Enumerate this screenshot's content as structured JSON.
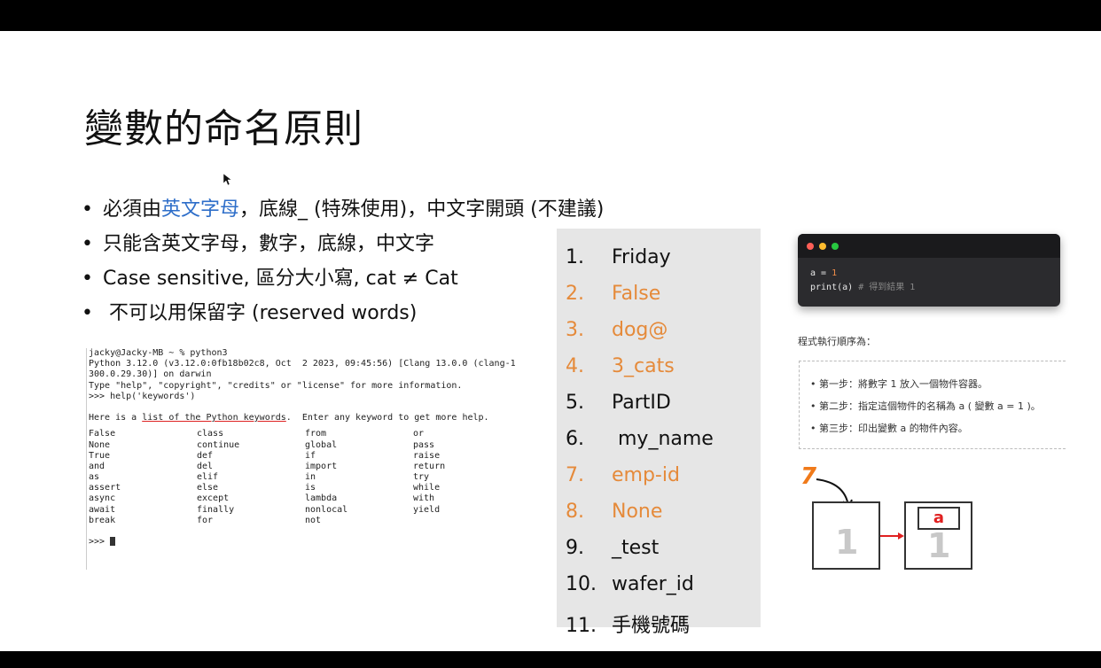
{
  "title": "變數的命名原則",
  "bullets": [
    {
      "pre": "必須由",
      "highlight": "英文字母",
      "post": "，底線_ (特殊使用)，中文字開頭 (不建議)"
    },
    {
      "pre": "只能含英文字母，數字，底線，中文字",
      "highlight": "",
      "post": ""
    },
    {
      "pre": "Case sensitive, 區分大小寫, cat ≠ Cat",
      "highlight": "",
      "post": ""
    },
    {
      "pre": " 不可以用保留字 (reserved words)",
      "highlight": "",
      "post": ""
    }
  ],
  "terminal": {
    "lines": [
      "jacky@Jacky-MB ~ % python3",
      "Python 3.12.0 (v3.12.0:0fb18b02c8, Oct  2 2023, 09:45:56) [Clang 13.0.0 (clang-1",
      "300.0.29.30)] on darwin",
      "Type \"help\", \"copyright\", \"credits\" or \"license\" for more information.",
      ">>> help('keywords')",
      ""
    ],
    "help_pre": "Here is a ",
    "help_link": "list of the Python keywords",
    "help_post": ".  Enter any keyword to get more help.",
    "keywords": [
      "False",
      "class",
      "from",
      "or",
      "None",
      "continue",
      "global",
      "pass",
      "True",
      "def",
      "if",
      "raise",
      "and",
      "del",
      "import",
      "return",
      "as",
      "elif",
      "in",
      "try",
      "assert",
      "else",
      "is",
      "while",
      "async",
      "except",
      "lambda",
      "with",
      "await",
      "finally",
      "nonlocal",
      "yield",
      "break",
      "for",
      "not",
      ""
    ],
    "prompt": ">>> "
  },
  "names": [
    {
      "num": "1.",
      "text": "Friday",
      "color": "#111111"
    },
    {
      "num": "2.",
      "text": "False",
      "color": "#e58a3a"
    },
    {
      "num": "3.",
      "text": "dog@",
      "color": "#e58a3a"
    },
    {
      "num": "4.",
      "text": "3_cats",
      "color": "#e58a3a"
    },
    {
      "num": "5.",
      "text": "PartID",
      "color": "#111111"
    },
    {
      "num": "6.",
      "text": " my_name",
      "color": "#111111"
    },
    {
      "num": "7.",
      "text": "emp-id",
      "color": "#e58a3a"
    },
    {
      "num": "8.",
      "text": "None",
      "color": "#e58a3a"
    },
    {
      "num": "9.",
      "text": "_test",
      "color": "#111111"
    },
    {
      "num": "10.",
      "text": "wafer_id",
      "color": "#111111"
    },
    {
      "num": "11.",
      "text": "手機號碼",
      "color": "#111111"
    }
  ],
  "code": {
    "line1_pre": "a = ",
    "line1_num": "1",
    "line2_pre": "print(a) ",
    "line2_comment": "# 得到結果 1"
  },
  "order_label": "程式執行順序為：",
  "steps": [
    "•  第一步：將數字 1 放入一個物件容器。",
    "•  第二步：指定這個物件的名稱為 a ( 變數 a = 1 )。",
    "•  第三步：印出變數 a 的物件內容。"
  ],
  "diagram": {
    "one": "1",
    "seven": "7",
    "label": "a"
  },
  "controls": {
    "prev": "prev-icon",
    "pen": "pen-icon",
    "zoom": "zoom-icon",
    "cc": "CC",
    "camera": "camera-icon",
    "more": "more-icon",
    "next": "next-icon"
  }
}
